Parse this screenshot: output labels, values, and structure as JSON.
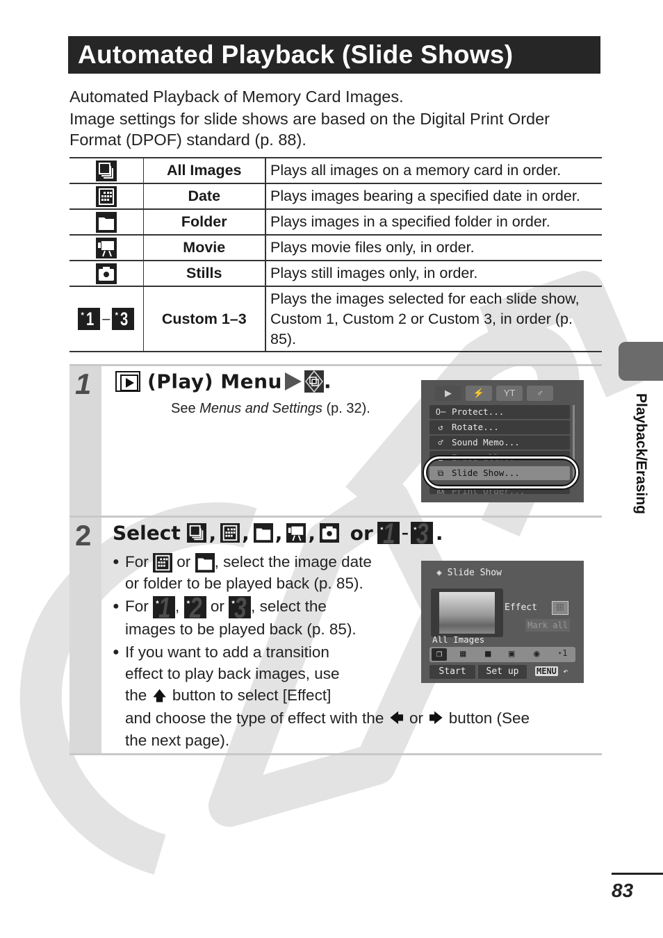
{
  "page": {
    "title": "Automated Playback (Slide Shows)",
    "intro": [
      "Automated Playback of Memory Card Images.",
      "Image settings for slide shows are based on the Digital Print Order Format (DPOF) standard (p. 88)."
    ],
    "side_tab_label": "Playback/Erasing",
    "page_number": "83"
  },
  "modes_table": {
    "rows": [
      {
        "icon": "all-images-icon",
        "name": "All Images",
        "desc": "Plays all images on a memory card in order."
      },
      {
        "icon": "date-icon",
        "name": "Date",
        "desc": "Plays images bearing a specified date in order."
      },
      {
        "icon": "folder-icon",
        "name": "Folder",
        "desc": "Plays images in a specified folder in order."
      },
      {
        "icon": "movie-icon",
        "name": "Movie",
        "desc": "Plays movie files only, in order."
      },
      {
        "icon": "stills-icon",
        "name": "Stills",
        "desc": "Plays still images only, in order."
      },
      {
        "icon": "custom-icon",
        "name": "Custom 1–3",
        "desc": "Plays the images selected for each slide show, Custom 1, Custom 2 or Custom 3, in order (p. 85).",
        "icon_labels": [
          "1",
          "3"
        ],
        "separator": "–"
      }
    ]
  },
  "step1": {
    "number": "1",
    "heading": "(Play) Menu",
    "period": ".",
    "see_prefix": "See ",
    "see_italic": "Menus and Settings",
    "see_suffix": " (p. 32).",
    "screen": {
      "tabs": [
        "▶",
        "⚡",
        "YT",
        "♂"
      ],
      "items": [
        {
          "icon": "key-icon",
          "glyph": "O─",
          "label": "Protect..."
        },
        {
          "icon": "rotate-icon",
          "glyph": "↺",
          "label": "Rotate..."
        },
        {
          "icon": "mic-icon",
          "glyph": "♂",
          "label": "Sound Memo..."
        },
        {
          "icon": "erase-icon",
          "glyph": "⌂",
          "label": "Erase all..."
        },
        {
          "icon": "slideshow-icon",
          "glyph": "⧉",
          "label": "Slide Show...",
          "selected": true
        },
        {
          "icon": "print-icon",
          "glyph": "⎙",
          "label": "Print Order..."
        }
      ]
    }
  },
  "step2": {
    "number": "2",
    "heading_prefix": "Select",
    "heading_or": "or",
    "heading_dash": "–",
    "heading_period": ".",
    "custom_labels": [
      "1",
      "2",
      "3"
    ],
    "bullet1": {
      "for": "For",
      "or": "or",
      "rest": ", select the image date",
      "line2": "or folder to be played back (p. 85)."
    },
    "bullet2": {
      "for": "For",
      "comma": ",",
      "or": "or",
      "rest": ", select the",
      "line2": "images to be played back (p. 85)."
    },
    "bullet3": {
      "line1": "If you want to add a transition",
      "line2": "effect to play back images, use",
      "line3_pre": "the",
      "line3_post": "button to select [Effect]",
      "line4_pre": "and choose the type of effect with the",
      "line4_or": "or",
      "line4_post": "button (See",
      "line5": "the next page)."
    },
    "screen": {
      "title": "Slide Show",
      "effect_label": "Effect",
      "mark_all": "Mark all",
      "mode_label": "All Images",
      "mode_icons": [
        "all-images",
        "date",
        "folder",
        "movie",
        "stills",
        "custom-1"
      ],
      "custom_label": "⋆1",
      "start": "Start",
      "setup": "Set up",
      "menu": "MENU",
      "back": "⮌"
    }
  }
}
